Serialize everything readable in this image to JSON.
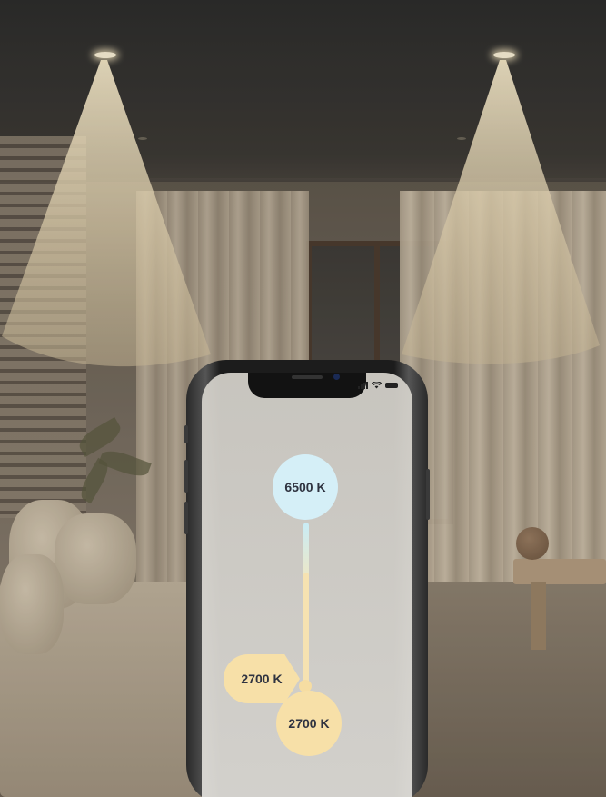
{
  "scene": {
    "colors": {
      "cool_light": "#d5eff7",
      "warm_light": "#f7e0a8",
      "badge_text": "#2f3340"
    }
  },
  "phone": {
    "status_icons": [
      "signal-icon",
      "wifi-icon",
      "battery-icon"
    ],
    "color_temperature": {
      "cool_label": "6500 K",
      "warm_label_a": "2700 K",
      "warm_label_b": "2700 K"
    }
  }
}
